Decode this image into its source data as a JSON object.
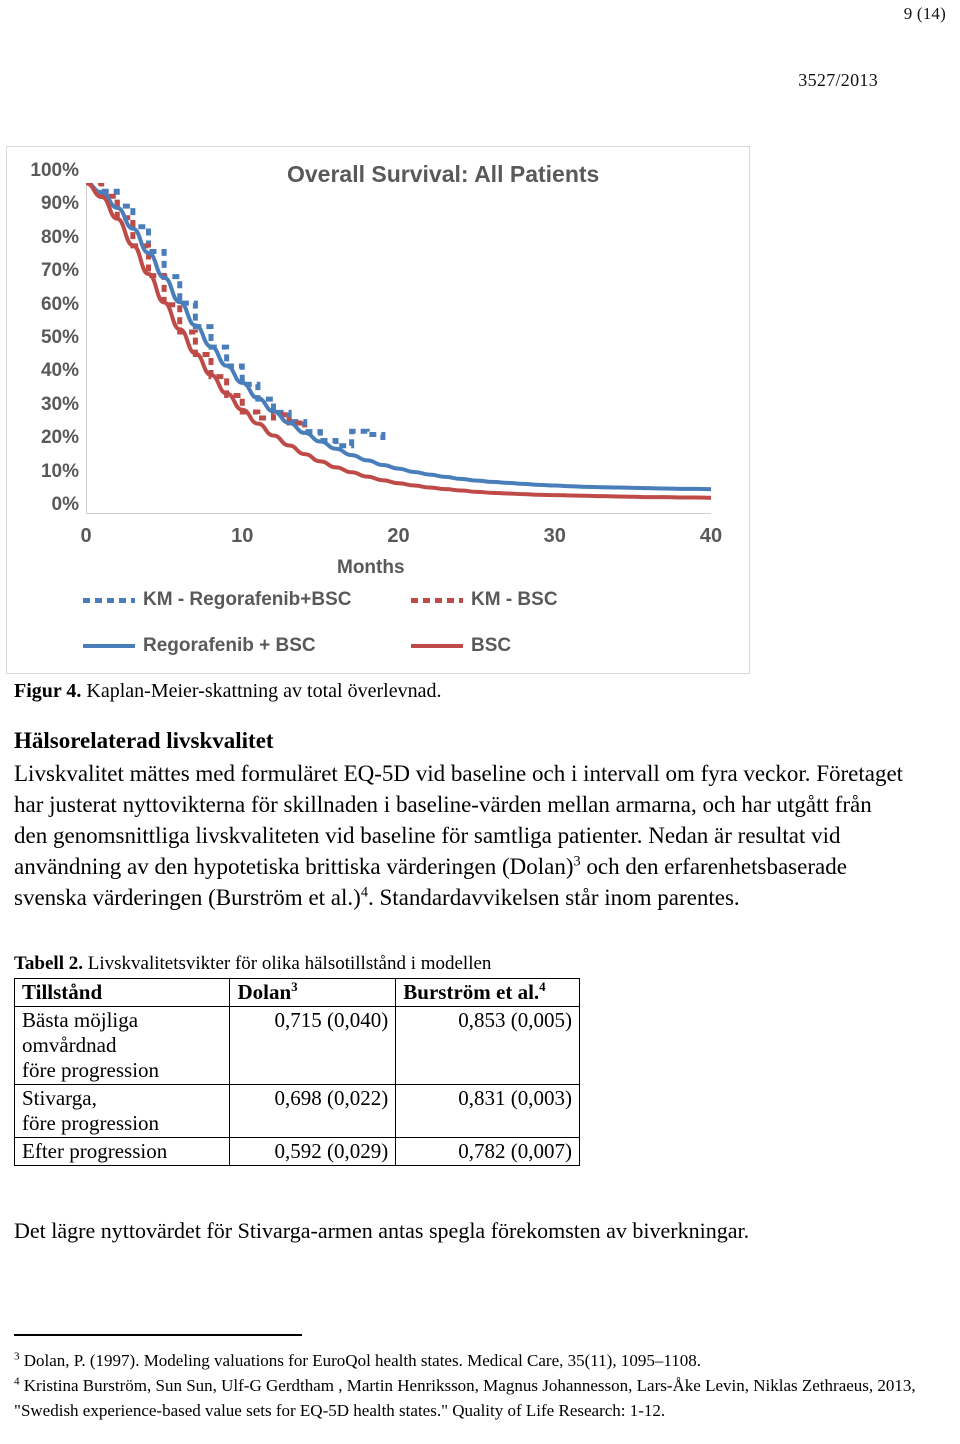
{
  "header": {
    "page_number": "9 (14)",
    "doc_id": "3527/2013"
  },
  "chart": {
    "title": "Overall Survival: All Patients",
    "xlabel": "Months",
    "y_ticks": [
      "100%",
      "90%",
      "80%",
      "70%",
      "60%",
      "50%",
      "40%",
      "30%",
      "20%",
      "10%",
      "0%"
    ],
    "x_ticks": [
      "0",
      "10",
      "20",
      "30",
      "40"
    ],
    "legend": [
      {
        "label": "KM - Regorafenib+BSC",
        "style": "dashed",
        "color": "#4a7ebb"
      },
      {
        "label": "KM - BSC",
        "style": "dashed",
        "color": "#be4b48"
      },
      {
        "label": "Regorafenib + BSC",
        "style": "solid",
        "color": "#4a7ebb"
      },
      {
        "label": "BSC",
        "style": "solid",
        "color": "#be4b48"
      }
    ]
  },
  "chart_data": {
    "type": "line",
    "title": "Overall Survival: All Patients",
    "xlabel": "Months",
    "ylabel": "",
    "xlim": [
      0,
      40
    ],
    "ylim": [
      0,
      1
    ],
    "xticks": [
      0,
      10,
      20,
      30,
      40
    ],
    "yticks": [
      0,
      0.1,
      0.2,
      0.3,
      0.4,
      0.5,
      0.6,
      0.7,
      0.8,
      0.9,
      1.0
    ],
    "ytick_labels": [
      "0%",
      "10%",
      "20%",
      "30%",
      "40%",
      "50%",
      "60%",
      "70%",
      "80%",
      "90%",
      "100%"
    ],
    "grid": false,
    "legend_position": "bottom",
    "x": [
      0,
      1,
      2,
      3,
      4,
      5,
      6,
      7,
      8,
      9,
      10,
      11,
      12,
      13,
      14,
      15,
      16,
      17,
      18,
      19,
      20,
      21,
      22,
      23,
      24,
      25,
      26,
      27,
      28,
      29,
      30,
      31,
      32,
      33,
      34,
      35,
      36,
      37,
      38,
      39,
      40
    ],
    "series": [
      {
        "name": "Regorafenib + BSC",
        "style": "solid",
        "color": "#4a7ebb",
        "values": [
          1.0,
          0.972,
          0.925,
          0.862,
          0.789,
          0.714,
          0.64,
          0.57,
          0.506,
          0.448,
          0.396,
          0.35,
          0.31,
          0.275,
          0.245,
          0.219,
          0.197,
          0.178,
          0.162,
          0.148,
          0.137,
          0.127,
          0.119,
          0.112,
          0.106,
          0.101,
          0.097,
          0.094,
          0.091,
          0.088,
          0.086,
          0.084,
          0.082,
          0.081,
          0.08,
          0.079,
          0.078,
          0.077,
          0.076,
          0.076,
          0.075
        ]
      },
      {
        "name": "BSC",
        "style": "solid",
        "color": "#be4b48",
        "values": [
          1.0,
          0.958,
          0.892,
          0.812,
          0.725,
          0.639,
          0.558,
          0.485,
          0.42,
          0.364,
          0.315,
          0.273,
          0.237,
          0.207,
          0.181,
          0.159,
          0.141,
          0.126,
          0.113,
          0.102,
          0.093,
          0.086,
          0.08,
          0.075,
          0.071,
          0.067,
          0.064,
          0.062,
          0.06,
          0.058,
          0.057,
          0.056,
          0.055,
          0.054,
          0.053,
          0.052,
          0.051,
          0.051,
          0.05,
          0.05,
          0.049
        ]
      },
      {
        "name": "KM - Regorafenib+BSC",
        "style": "dashed",
        "color": "#4a7ebb",
        "values": [
          1.0,
          0.975,
          0.93,
          0.868,
          0.793,
          0.717,
          0.637,
          0.566,
          0.504,
          0.447,
          0.392,
          0.347,
          0.307,
          0.279,
          0.249,
          0.222,
          0.206,
          0.25,
          0.24,
          0.21,
          null,
          null,
          null,
          null,
          null,
          null,
          null,
          null,
          null,
          null,
          null,
          null,
          null,
          null,
          null,
          null,
          null,
          null,
          null,
          null,
          null
        ]
      },
      {
        "name": "KM - BSC",
        "style": "dashed",
        "color": "#be4b48",
        "values": [
          1.0,
          0.96,
          0.895,
          0.81,
          0.72,
          0.632,
          0.55,
          0.482,
          0.415,
          0.358,
          0.308,
          0.29,
          0.3,
          0.275,
          0.262,
          null,
          null,
          null,
          null,
          null,
          null,
          null,
          null,
          null,
          null,
          null,
          null,
          null,
          null,
          null,
          null,
          null,
          null,
          null,
          null,
          null,
          null,
          null,
          null,
          null,
          null
        ]
      }
    ]
  },
  "figure_caption": {
    "label": "Figur 4.",
    "text": " Kaplan-Meier-skattning av total överlevnad."
  },
  "section": {
    "heading": "Hälsorelaterad livskvalitet",
    "paragraph_part1": "Livskvalitet mättes med formuläret EQ-5D vid baseline och i intervall om fyra veckor. Företaget har justerat nyttovikterna för skillnaden i baseline-värden mellan armarna, och har utgått från den genomsnittliga livskvaliteten vid baseline för samtliga patienter. Nedan är resultat vid användning av den hypotetiska brittiska värderingen (Dolan)",
    "sup1": "3",
    "paragraph_part2": " och den erfarenhetsbaserade svenska värderingen (Burström et al.)",
    "sup2": "4",
    "paragraph_part3": ". Standardavvikelsen står inom parentes."
  },
  "table": {
    "caption_label": "Tabell 2.",
    "caption_text": " Livskvalitetsvikter för olika hälsotillstånd i modellen",
    "headers": {
      "col1": "Tillstånd",
      "col2": "Dolan",
      "col2_sup": "3",
      "col3": "Burström et al.",
      "col3_sup": "4"
    },
    "rows": [
      {
        "state": "Bästa möjliga\nomvårdnad\nföre progression",
        "dolan": "0,715 (0,040)",
        "burstrom": "0,853 (0,005)"
      },
      {
        "state": "Stivarga,\nföre progression",
        "dolan": "0,698 (0,022)",
        "burstrom": "0,831 (0,003)"
      },
      {
        "state": "Efter progression",
        "dolan": "0,592 (0,029)",
        "burstrom": "0,782 (0,007)"
      }
    ]
  },
  "closing_text": "Det lägre nyttovärdet för Stivarga-armen antas spegla förekomsten av biverkningar.",
  "footnotes": [
    {
      "mark": "3",
      "text": " Dolan, P. (1997). Modeling valuations for EuroQol health states. Medical Care, 35(11), 1095–1108."
    },
    {
      "mark": "4",
      "text": " Kristina Burström, Sun Sun, Ulf-G Gerdtham , Martin Henriksson, Magnus Johannesson, Lars-Åke Levin, Niklas Zethraeus, 2013, \"Swedish experience-based value sets for EQ-5D health states.\" Quality of Life Research: 1-12."
    }
  ]
}
